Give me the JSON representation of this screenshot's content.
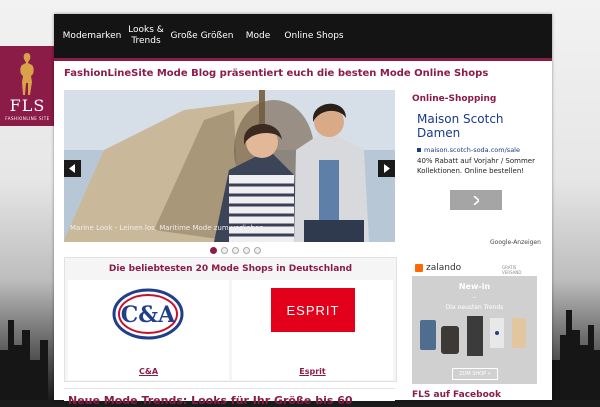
{
  "logo": {
    "text": "FLS",
    "subtext": "FASHIONLINE SITE"
  },
  "nav": {
    "items": [
      "Modemarken",
      "Looks & Trends",
      "Große Größen",
      "Mode",
      "Online Shops"
    ]
  },
  "headline": "FashionLineSite Mode Blog präsentiert euch die besten Mode Online Shops",
  "slider": {
    "caption": "Marine Look - Leinen los, Maritime Mode zum verlieben",
    "prev_icon": "chevron-left-icon",
    "next_icon": "chevron-right-icon",
    "dots": 5,
    "active_dot": 1
  },
  "shops": {
    "title": "Die beliebtesten 20 Mode Shops in Deutschland",
    "items": [
      {
        "name": "C&A",
        "logo": "C&A"
      },
      {
        "name": "Esprit",
        "logo": "ESPRIT"
      }
    ]
  },
  "bottom_title": "Neue Mode Trends: Looks für Ihr Größe bis 60",
  "sidebar": {
    "online_shopping_heading": "Online-Shopping",
    "ad": {
      "title": "Maison Scotch Damen",
      "url": "maison.scotch-soda.com/sale",
      "text": "40% Rabatt auf Vorjahr / Sommer Kollektionen. Online bestellen!",
      "button_icon": "chevron-right-icon",
      "ad_choice": "Google-Anzeigen"
    },
    "zalando": {
      "brand": "zalando",
      "badge": "GRATIS VERSAND",
      "new_in": "New-in",
      "dash": "–",
      "subtitle": "Die neusten Trends",
      "button": "ZUM SHOP »"
    },
    "facebook_heading": "FLS auf Facebook"
  },
  "colors": {
    "accent": "#8b1b47",
    "nav_bg": "#141414",
    "ad_link": "#1a3a8a"
  }
}
